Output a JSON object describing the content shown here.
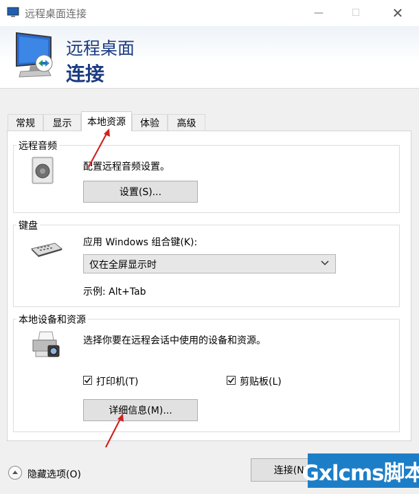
{
  "window": {
    "title": "远程桌面连接",
    "minimize_icon": "—",
    "maximize_icon": "☐",
    "close_icon": "✕"
  },
  "banner": {
    "line1": "远程桌面",
    "line2": "连接"
  },
  "tabs": [
    {
      "label": "常规"
    },
    {
      "label": "显示"
    },
    {
      "label": "本地资源",
      "selected": true
    },
    {
      "label": "体验"
    },
    {
      "label": "高级"
    }
  ],
  "remote_audio": {
    "title": "远程音频",
    "description": "配置远程音频设置。",
    "settings_button": "设置(S)..."
  },
  "keyboard": {
    "title": "键盘",
    "label": "应用 Windows 组合键(K):",
    "selected_option": "仅在全屏显示时",
    "example": "示例: Alt+Tab"
  },
  "local_devices": {
    "title": "本地设备和资源",
    "description": "选择你要在远程会话中使用的设备和资源。",
    "printers_label": "打印机(T)",
    "printers_checked": true,
    "clipboard_label": "剪贴板(L)",
    "clipboard_checked": true,
    "details_button": "详细信息(M)..."
  },
  "footer": {
    "hide_options": "隐藏选项(O)",
    "connect_button": "连接(N)"
  },
  "watermark": "Gxlcms脚本",
  "colors": {
    "banner_text": "#1c3c82",
    "annotation_arrow": "#d2221f",
    "watermark_bg": "#1d7ec8"
  }
}
